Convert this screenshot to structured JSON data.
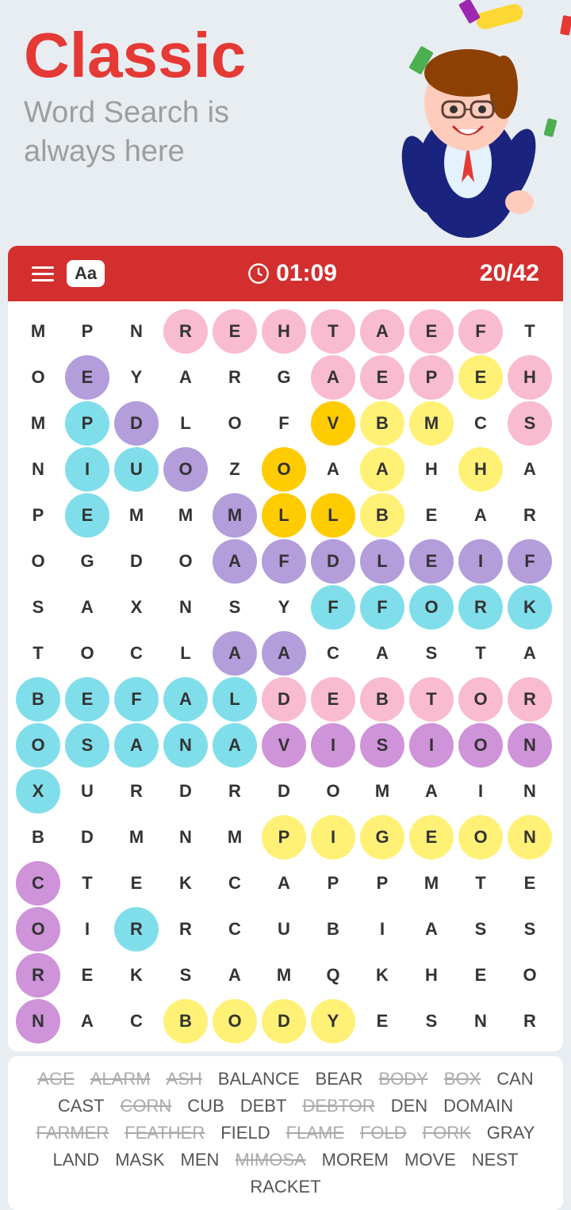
{
  "header": {
    "title": "Classic",
    "subtitle_line1": "Word Search is",
    "subtitle_line2": "always here"
  },
  "toolbar": {
    "timer": "01:09",
    "score": "20/42",
    "font_label": "Aa"
  },
  "grid": {
    "rows": [
      [
        "M",
        "P",
        "N",
        "R",
        "E",
        "H",
        "T",
        "A",
        "E",
        "F",
        "T"
      ],
      [
        "O",
        "E",
        "Y",
        "A",
        "R",
        "G",
        "A",
        "E",
        "P",
        "E",
        "H"
      ],
      [
        "M",
        "P",
        "D",
        "L",
        "O",
        "F",
        "V",
        "B",
        "M",
        "C",
        "S"
      ],
      [
        "N",
        "I",
        "U",
        "O",
        "Z",
        "O",
        "A",
        "A",
        "H",
        "H",
        "A"
      ],
      [
        "P",
        "E",
        "M",
        "M",
        "M",
        "L",
        "L",
        "B",
        "E",
        "A",
        "R"
      ],
      [
        "O",
        "G",
        "D",
        "O",
        "A",
        "F",
        "D",
        "L",
        "E",
        "I",
        "F"
      ],
      [
        "S",
        "A",
        "X",
        "N",
        "S",
        "Y",
        "F",
        "F",
        "O",
        "R",
        "K"
      ],
      [
        "T",
        "O",
        "C",
        "L",
        "A",
        "A",
        "C",
        "A",
        "S",
        "T",
        "A"
      ],
      [
        "B",
        "E",
        "F",
        "A",
        "L",
        "D",
        "E",
        "B",
        "T",
        "O",
        "R"
      ],
      [
        "O",
        "S",
        "A",
        "N",
        "A",
        "V",
        "I",
        "S",
        "I",
        "O",
        "N"
      ],
      [
        "X",
        "U",
        "R",
        "D",
        "R",
        "D",
        "O",
        "M",
        "A",
        "I",
        "N"
      ],
      [
        "B",
        "D",
        "M",
        "N",
        "M",
        "P",
        "I",
        "G",
        "E",
        "O",
        "N"
      ],
      [
        "C",
        "T",
        "E",
        "K",
        "C",
        "A",
        "P",
        "P",
        "M",
        "T",
        "E"
      ],
      [
        "O",
        "I",
        "R",
        "R",
        "C",
        "U",
        "B",
        "I",
        "A",
        "S",
        "S"
      ],
      [
        "R",
        "E",
        "K",
        "S",
        "A",
        "M",
        "Q",
        "K",
        "H",
        "E",
        "O"
      ],
      [
        "N",
        "A",
        "C",
        "B",
        "O",
        "D",
        "Y",
        "E",
        "S",
        "N",
        "R"
      ]
    ]
  },
  "highlights": {
    "rehtaef": {
      "color": "pink",
      "cells": [
        [
          0,
          3
        ],
        [
          0,
          4
        ],
        [
          0,
          5
        ],
        [
          0,
          6
        ],
        [
          0,
          7
        ],
        [
          0,
          8
        ],
        [
          0,
          9
        ]
      ]
    },
    "fork": {
      "color": "blue",
      "cells": [
        [
          6,
          7
        ],
        [
          6,
          8
        ],
        [
          6,
          9
        ],
        [
          6,
          10
        ]
      ]
    },
    "debtor": {
      "color": "pink",
      "cells": [
        [
          8,
          5
        ],
        [
          8,
          6
        ],
        [
          8,
          7
        ],
        [
          8,
          8
        ],
        [
          8,
          9
        ],
        [
          8,
          10
        ]
      ]
    },
    "vision": {
      "color": "purple",
      "cells": [
        [
          9,
          5
        ],
        [
          9,
          6
        ],
        [
          9,
          7
        ],
        [
          9,
          8
        ],
        [
          9,
          9
        ],
        [
          9,
          10
        ]
      ]
    },
    "pigeon": {
      "color": "yellow",
      "cells": [
        [
          11,
          5
        ],
        [
          11,
          6
        ],
        [
          11,
          7
        ],
        [
          11,
          8
        ],
        [
          11,
          9
        ],
        [
          11,
          10
        ]
      ]
    },
    "body": {
      "color": "yellow",
      "cells": [
        [
          15,
          3
        ],
        [
          15,
          4
        ],
        [
          15,
          5
        ],
        [
          15,
          6
        ]
      ]
    },
    "box": {
      "color": "blue",
      "cells": [
        [
          8,
          0
        ],
        [
          9,
          0
        ],
        [
          10,
          0
        ]
      ]
    },
    "feather_diag": {
      "color": "orange"
    },
    "corn": {
      "color": "purple",
      "cells": [
        [
          12,
          0
        ],
        [
          13,
          0
        ],
        [
          14,
          0
        ],
        [
          15,
          0
        ]
      ]
    },
    "air_diag": {
      "color": "lavender"
    }
  },
  "words": [
    {
      "text": "AGE",
      "found": true
    },
    {
      "text": "ALARM",
      "found": true
    },
    {
      "text": "ASH",
      "found": true
    },
    {
      "text": "BALANCE",
      "found": false
    },
    {
      "text": "BEAR",
      "found": false
    },
    {
      "text": "BODY",
      "found": true
    },
    {
      "text": "BOX",
      "found": true
    },
    {
      "text": "CAN",
      "found": false
    },
    {
      "text": "CAST",
      "found": false
    },
    {
      "text": "CORN",
      "found": true
    },
    {
      "text": "CUB",
      "found": false
    },
    {
      "text": "DEBT",
      "found": false
    },
    {
      "text": "DEBTOR",
      "found": true
    },
    {
      "text": "DEN",
      "found": false
    },
    {
      "text": "DOMAIN",
      "found": false
    },
    {
      "text": "FARMER",
      "found": true
    },
    {
      "text": "FEATHER",
      "found": true
    },
    {
      "text": "FIELD",
      "found": false
    },
    {
      "text": "FLAME",
      "found": true
    },
    {
      "text": "FOLD",
      "found": true
    },
    {
      "text": "FORK",
      "found": true
    },
    {
      "text": "GRAY",
      "found": false
    },
    {
      "text": "LAND",
      "found": false
    },
    {
      "text": "MASK",
      "found": false
    },
    {
      "text": "MEN",
      "found": false
    },
    {
      "text": "MIMOSA",
      "found": true
    },
    {
      "text": "MOREM",
      "found": false
    },
    {
      "text": "MOVE",
      "found": false
    },
    {
      "text": "NEST",
      "found": false
    },
    {
      "text": "RACKET",
      "found": false
    }
  ]
}
